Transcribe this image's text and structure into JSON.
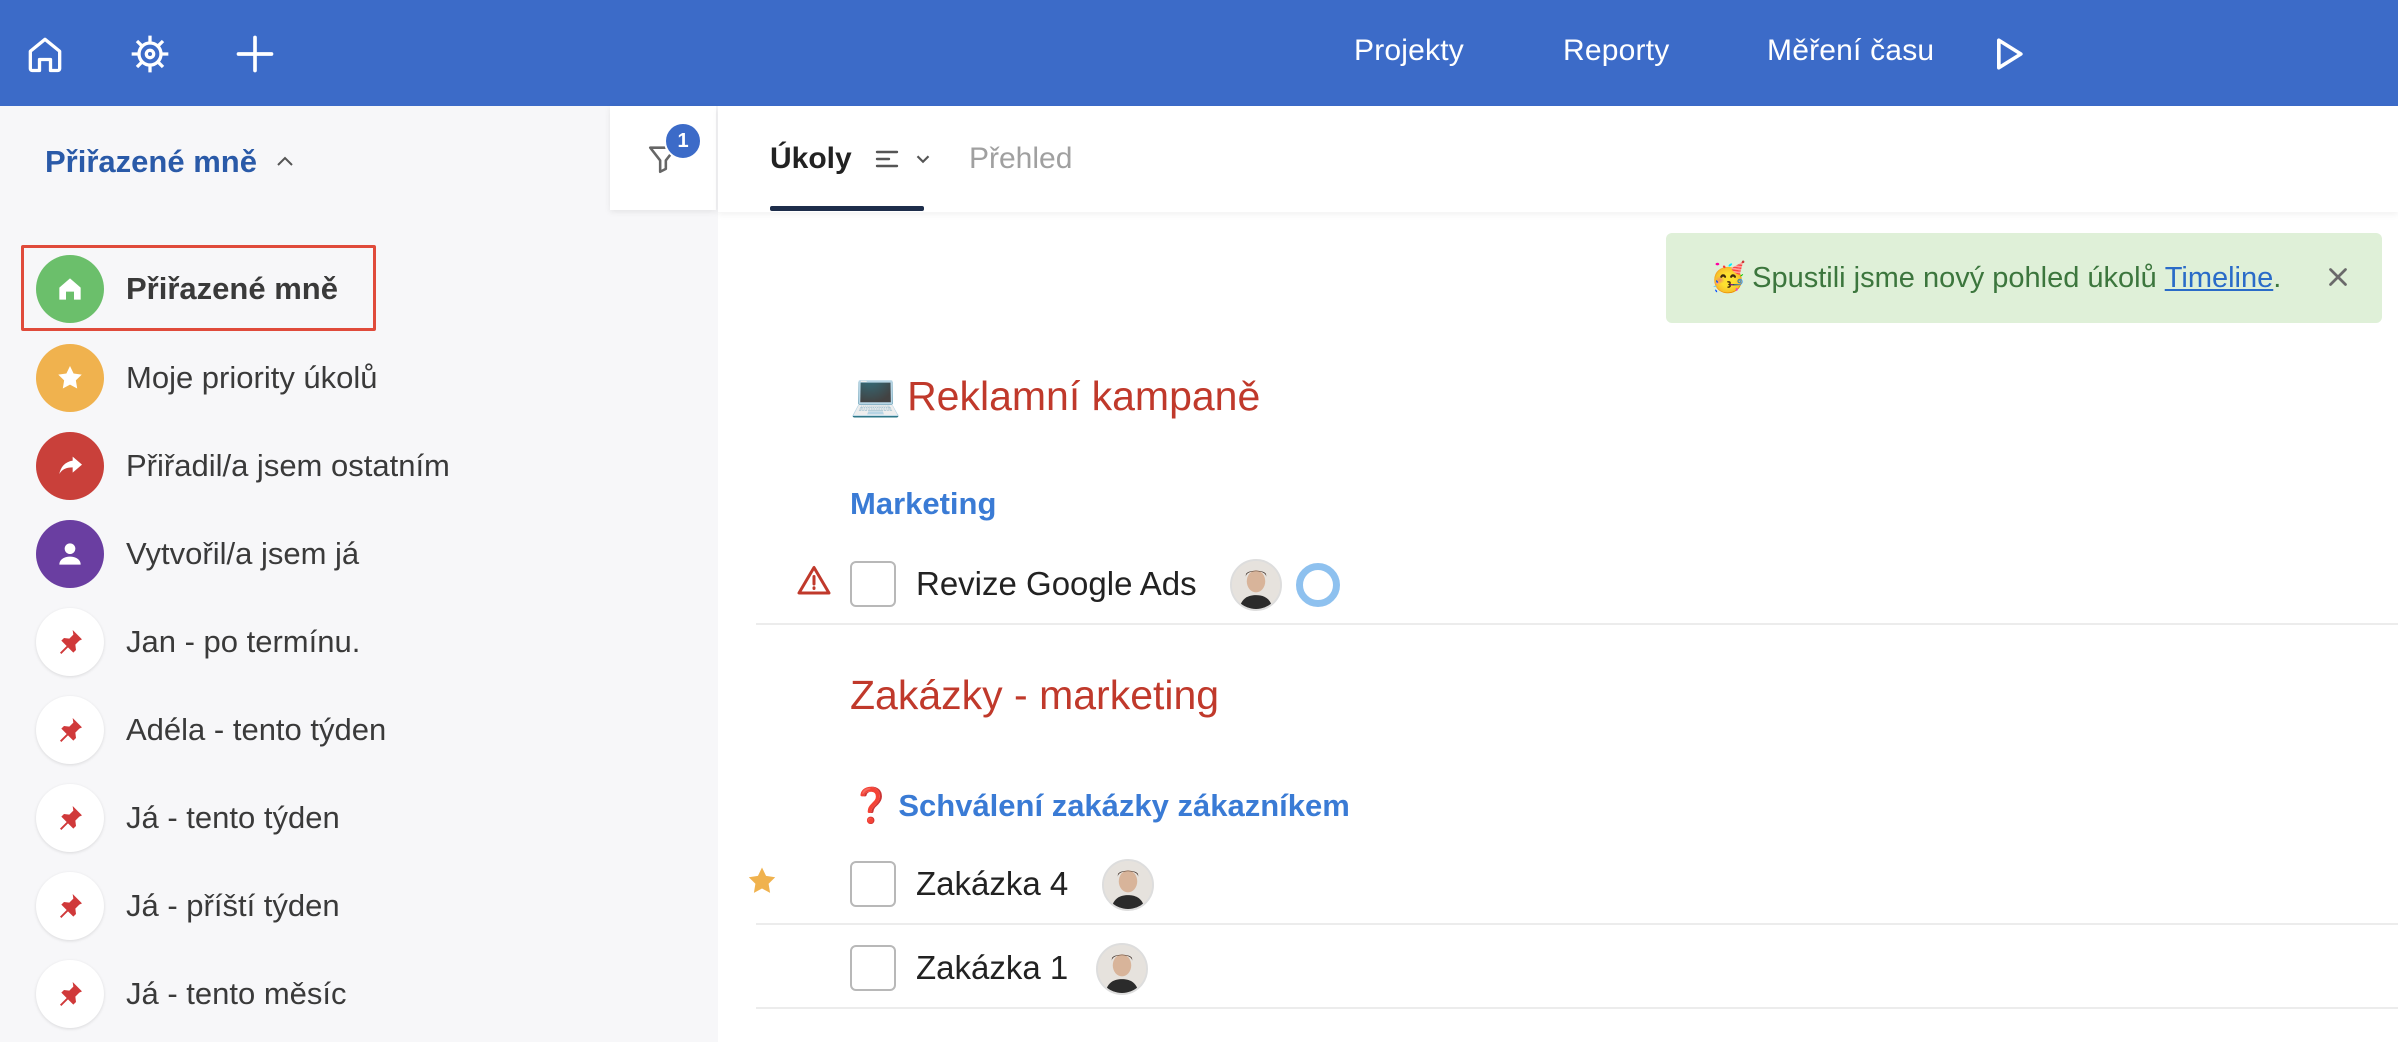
{
  "topbar": {
    "icons": [
      "home-icon",
      "helm-icon",
      "plus-icon"
    ],
    "links": [
      "Projekty",
      "Reporty",
      "Měření času"
    ],
    "timer_icon": "play-icon"
  },
  "sidebar": {
    "header": "Přiřazené mně",
    "filter_badge": "1",
    "items": [
      {
        "label": "Přiřazené mně",
        "icon": "home-icon",
        "color": "#6bbf6b"
      },
      {
        "label": "Moje priority úkolů",
        "icon": "star-icon",
        "color": "#f0b24e"
      },
      {
        "label": "Přiřadil/a jsem ostatním",
        "icon": "share-arrow-icon",
        "color": "#c9403a"
      },
      {
        "label": "Vytvořil/a jsem já",
        "icon": "user-icon",
        "color": "#6a3ea1"
      },
      {
        "label": "Jan - po termínu.",
        "icon": "pin-icon"
      },
      {
        "label": "Adéla - tento týden",
        "icon": "pin-icon"
      },
      {
        "label": "Já - tento týden",
        "icon": "pin-icon"
      },
      {
        "label": "Já - příští týden",
        "icon": "pin-icon"
      },
      {
        "label": "Já - tento měsíc",
        "icon": "pin-icon"
      }
    ]
  },
  "tabs": {
    "active": "Úkoly",
    "other": "Přehled"
  },
  "banner": {
    "emoji": "🥳",
    "text": "Spustili jsme nový pohled úkolů",
    "link": "Timeline",
    "suffix": "."
  },
  "sections": [
    {
      "emoji": "💻",
      "title": "Reklamní kampaně",
      "groups": [
        {
          "title": "Marketing",
          "tasks": [
            {
              "name": "Revize Google Ads",
              "flag": "warning-icon"
            }
          ]
        }
      ]
    },
    {
      "title": "Zakázky - marketing",
      "groups": [
        {
          "prefix": "❓",
          "title": "Schválení zakázky zákazníkem",
          "tasks": [
            {
              "name": "Zakázka 4",
              "flag": "star-icon"
            },
            {
              "name": "Zakázka 1"
            }
          ]
        }
      ]
    }
  ],
  "colors": {
    "topbar": "#3c6bc8",
    "section_title": "#c0392b",
    "group_title": "#3a7bd5"
  }
}
